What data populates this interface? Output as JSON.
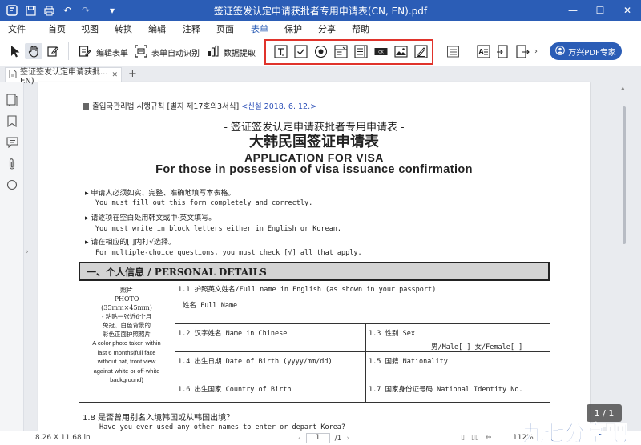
{
  "window": {
    "title": "签证签发认定申请获批者专用申请表(CN, EN).pdf"
  },
  "menu": {
    "items": [
      "文件",
      "首页",
      "视图",
      "转换",
      "编辑",
      "注释",
      "页面",
      "表单",
      "保护",
      "分享",
      "帮助"
    ],
    "active": "表单"
  },
  "toolbar": {
    "edit_form": "编辑表单",
    "auto_recognize": "表单自动识别",
    "data_extract": "数据提取",
    "pdf_expert": "万兴PDF专家"
  },
  "tabs": {
    "doc_tab": "签证签发认定申请获批... EN)"
  },
  "doc": {
    "header_ko": "출입국관리법 시행규칙 [별지 제17호의3서식] ",
    "header_date": "<신설 2018. 6. 12.>",
    "title_cn_small": "- 签证签发认定申请获批者专用申请表 -",
    "title_cn_big": "大韩民国签证申请表",
    "title_en1": "APPLICATION FOR VISA",
    "title_en2": "For those in possession of visa issuance confirmation",
    "inst1_cn": "▸ 申请人必须如实、完整、准确地填写本表格。",
    "inst1_en": "You must fill out this form completely and correctly.",
    "inst2_cn": "▸ 请逐项在空白处用韩文或中·英文填写。",
    "inst2_en": "You must write in block letters either in English or Korean.",
    "inst3_cn": "▸ 请在相应的[  ]内打√选择。",
    "inst3_en": "For multiple-choice questions, you must check [√] all that apply.",
    "section1": "一、个人信息 / PERSONAL DETAILS",
    "photo_cn": "照片",
    "photo_en": "PHOTO",
    "photo_size": "(35mm×45mm)",
    "photo_note1": "- 粘贴一张近6个月",
    "photo_note2": "免冠、白色背景的",
    "photo_note3": "彩色正面护照照片",
    "photo_note_en1": "A color photo taken within",
    "photo_note_en2": "last 6 months(full face",
    "photo_note_en3": "without hat, front view",
    "photo_note_en4": "against white or off-white",
    "photo_note_en5": "background)",
    "f11": "1.1 护照英文姓名/Full name in English (as shown in your passport)",
    "f11_sub": "姓名 Full Name",
    "f12": "1.2 汉字姓名 Name in Chinese",
    "f13": "1.3 性别 Sex",
    "f13_opts": "男/Male[   ]   女/Female[   ]",
    "f14": "1.4 出生日期 Date of Birth (yyyy/mm/dd)",
    "f15": "1.5 国籍 Nationality",
    "f16": "1.6 出生国家 Country of Birth",
    "f17": "1.7 国家身份证号码 National Identity No.",
    "q18": "1.8 是否曾用别名入境韩国或从韩国出境？",
    "q18_en": "Have you ever used any other names to enter or depart Korea?"
  },
  "viewer": {
    "page_badge": "1 / 1",
    "page_size": "8.26 X 11.68 in",
    "page_input": "1",
    "page_total": "/1",
    "zoom": "112%"
  },
  "watermark": {
    "text": "九七分享吧"
  },
  "colors": {
    "titlebar": "#2b5db6",
    "highlight_box": "#e0332b",
    "accent": "#2b5db6"
  }
}
